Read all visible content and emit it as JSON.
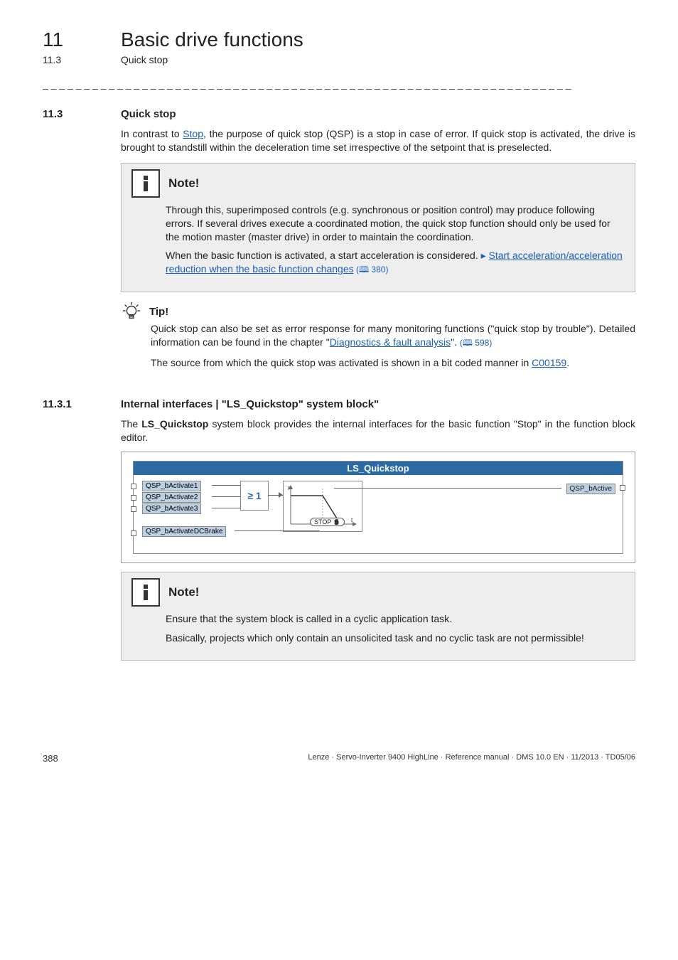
{
  "chapter": {
    "number": "11",
    "title": "Basic drive functions"
  },
  "subsection": {
    "number": "11.3",
    "title": "Quick stop"
  },
  "sections": {
    "s1": {
      "num": "11.3",
      "title": "Quick stop"
    },
    "s2": {
      "num": "11.3.1",
      "title": "Internal interfaces | \"LS_Quickstop\" system block\""
    }
  },
  "para": {
    "intro_pre": "In contrast to ",
    "intro_link": "Stop",
    "intro_post": ", the purpose of quick stop (QSP) is a stop in case of error. If quick stop is activated, the drive is brought to standstill within the deceleration time set irrespective of the setpoint that is preselected.",
    "s2_intro_pre": "The ",
    "s2_intro_bold": "LS_Quickstop",
    "s2_intro_post": " system block provides the internal interfaces for the basic function \"Stop\" in the function block editor."
  },
  "note1": {
    "title": "Note!",
    "body1": "Through this, superimposed controls (e.g. synchronous or position control) may produce following errors. If several drives execute a coordinated motion, the quick stop function should only be used for the motion master (master drive) in order to maintain the coordination.",
    "body2_pre": "When the basic function is activated, a start acceleration is considered.  ",
    "body2_link1": "Start acceleration/acceleration reduction when the basic function changes",
    "body2_ref": " (🕮 380)"
  },
  "tip": {
    "title": "Tip!",
    "p1_pre": "Quick stop can also be set as error response for many monitoring functions (\"quick stop by trouble\"). Detailed information can be found in the chapter \"",
    "p1_link": "Diagnostics & fault analysis",
    "p1_post": "\".",
    "p1_ref": "(🕮 598)",
    "p2_pre": "The source from which the quick stop was activated is shown in a bit coded manner in ",
    "p2_link": "C00159",
    "p2_post": "."
  },
  "diagram": {
    "title": "LS_Quickstop",
    "in1": "QSP_bActivate1",
    "in2": "QSP_bActivate2",
    "in3": "QSP_bActivate3",
    "in4": "QSP_bActivateDCBrake",
    "ge": "≥ 1",
    "n": "n",
    "stop": "STOP",
    "out": "QSP_bActive"
  },
  "note2": {
    "title": "Note!",
    "body1": "Ensure that the system block is called in a cyclic application task.",
    "body2": "Basically, projects which only contain an unsolicited task and no cyclic task are not permissible!"
  },
  "footer": {
    "page": "388",
    "info": "Lenze · Servo-Inverter 9400 HighLine · Reference manual · DMS 10.0 EN · 11/2013 · TD05/06"
  }
}
